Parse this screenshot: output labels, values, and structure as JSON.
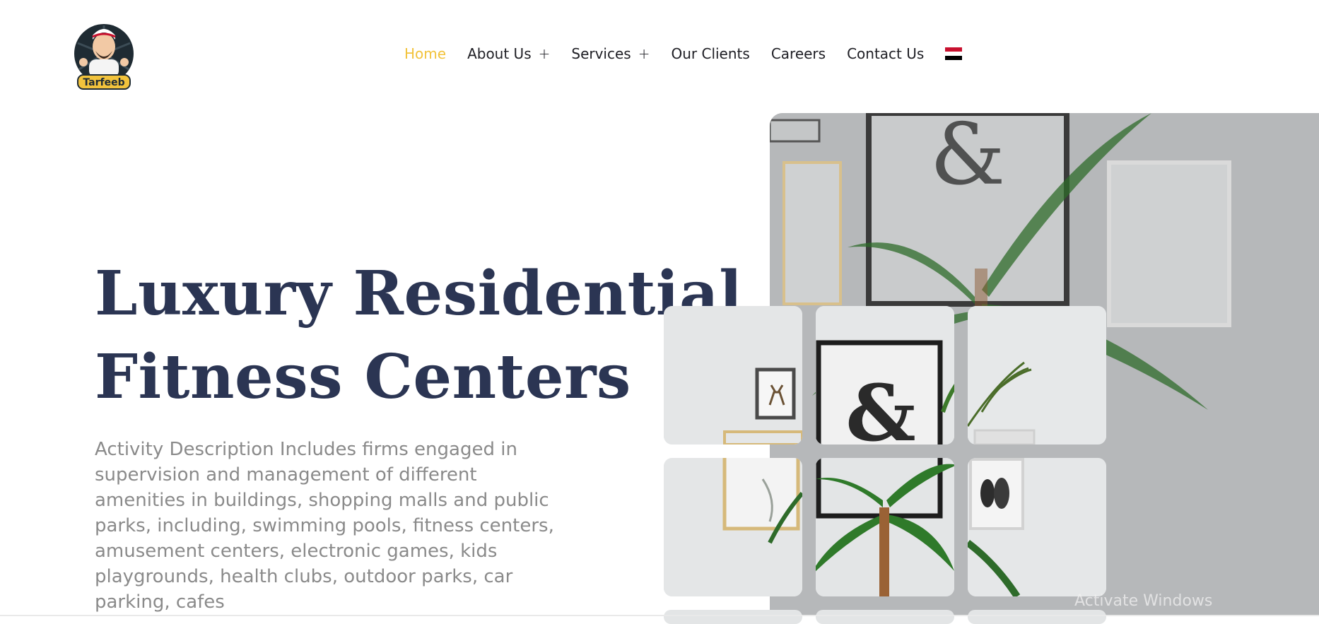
{
  "brand": {
    "logo_text": "Tarfeeb"
  },
  "nav": {
    "items": [
      {
        "label": "Home",
        "active": true,
        "has_submenu": false
      },
      {
        "label": "About Us",
        "active": false,
        "has_submenu": true
      },
      {
        "label": "Services",
        "active": false,
        "has_submenu": true
      },
      {
        "label": "Our Clients",
        "active": false,
        "has_submenu": false
      },
      {
        "label": "Careers",
        "active": false,
        "has_submenu": false
      },
      {
        "label": "Contact Us",
        "active": false,
        "has_submenu": false
      }
    ],
    "submenu_symbol": "+",
    "language_icon": "egypt-flag-icon"
  },
  "hero": {
    "title_line1": "Luxury Residential",
    "title_line2": "Fitness Centers",
    "description": "Activity Description Includes firms engaged in supervision and management of different amenities in buildings, shopping malls and public parks, including, swimming pools, fitness centers, amusement centers, electronic games, kids playgrounds, health clubs, outdoor parks, car parking, cafes"
  },
  "system": {
    "watermark": "Activate Windows"
  },
  "colors": {
    "accent": "#f2c33c",
    "heading": "#2b3553",
    "body_text": "#8a8a8a",
    "nav_text": "#1e1e24"
  }
}
